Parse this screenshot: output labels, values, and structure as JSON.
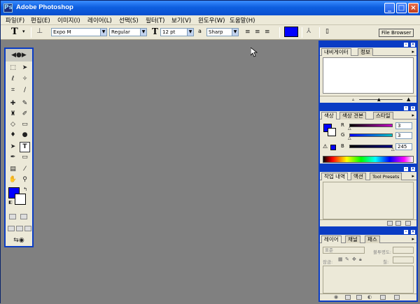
{
  "window": {
    "title": "Adobe Photoshop"
  },
  "menu": {
    "items": [
      "파일(F)",
      "편집(E)",
      "이미지(I)",
      "레이어(L)",
      "선택(S)",
      "필터(T)",
      "보기(V)",
      "윈도우(W)",
      "도움말(H)"
    ]
  },
  "options": {
    "font_family": "Expo M",
    "font_style": "Regular",
    "font_size": "12 pt",
    "aa_label": "a",
    "antialias": "Sharp",
    "text_color": "#0000ff",
    "file_browser": "File Browser"
  },
  "toolbox": {
    "foreground_color": "#0000ff",
    "background_color": "#ffffff",
    "tool_text_label": "T"
  },
  "panels": {
    "navigator": {
      "tabs": [
        "내비게이터",
        "정보"
      ]
    },
    "color": {
      "tabs": [
        "색상",
        "색상 견본",
        "스타일"
      ],
      "sliders": [
        {
          "label": "R",
          "value": "3",
          "track": "#c400c4"
        },
        {
          "label": "G",
          "value": "3",
          "track": "#00c0c0"
        },
        {
          "label": "B",
          "value": "245",
          "track": "#000080"
        }
      ]
    },
    "history": {
      "tabs": [
        "작업 내역",
        "액션",
        "Tool Presets"
      ]
    },
    "layers": {
      "tabs": [
        "레이어",
        "채널",
        "패스"
      ],
      "blend_mode": "표준",
      "opacity_label": "불투명도:",
      "lock_label": "잠금:",
      "fill_label": "칠:"
    }
  }
}
